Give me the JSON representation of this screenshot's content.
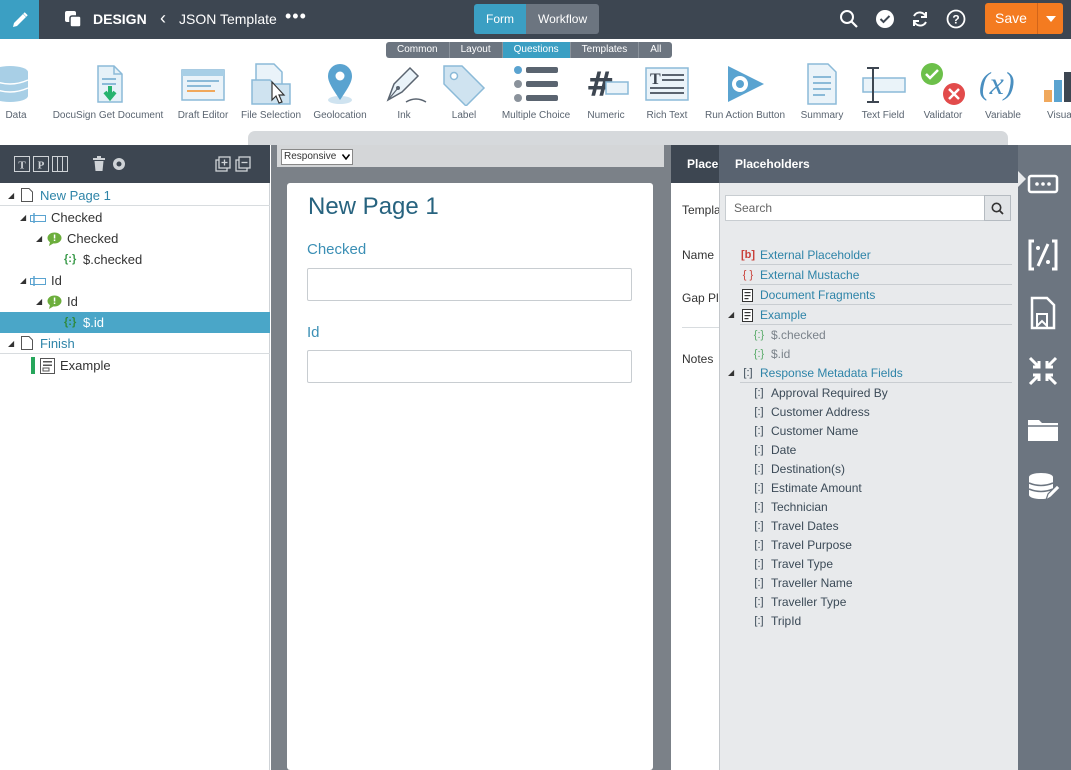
{
  "header": {
    "app_name": "DESIGN",
    "document_title": "JSON Template",
    "more": "•••",
    "mode_tabs": [
      {
        "label": "Form",
        "active": true
      },
      {
        "label": "Workflow",
        "active": false
      }
    ],
    "save_label": "Save",
    "accent_color": "#3b9fc3",
    "save_color": "#f47b20"
  },
  "toolbox": {
    "categories": [
      {
        "label": "Common",
        "active": false
      },
      {
        "label": "Layout",
        "active": false
      },
      {
        "label": "Questions",
        "active": true
      },
      {
        "label": "Templates",
        "active": false
      },
      {
        "label": "All",
        "active": false
      }
    ],
    "tools": [
      {
        "label": "Data",
        "icon": "database-icon"
      },
      {
        "label": "DocuSign Get Document",
        "icon": "docusign-document-icon"
      },
      {
        "label": "Draft Editor",
        "icon": "draft-editor-icon"
      },
      {
        "label": "File Selection",
        "icon": "file-selection-icon"
      },
      {
        "label": "Geolocation",
        "icon": "map-pin-icon"
      },
      {
        "label": "Ink",
        "icon": "pen-nib-icon"
      },
      {
        "label": "Label",
        "icon": "tag-icon"
      },
      {
        "label": "Multiple Choice",
        "icon": "list-icon"
      },
      {
        "label": "Numeric",
        "icon": "hash-icon"
      },
      {
        "label": "Rich Text",
        "icon": "rich-text-icon"
      },
      {
        "label": "Run Action Button",
        "icon": "gear-play-icon"
      },
      {
        "label": "Summary",
        "icon": "summary-document-icon"
      },
      {
        "label": "Text Field",
        "icon": "text-cursor-icon"
      },
      {
        "label": "Validator",
        "icon": "check-x-icon"
      },
      {
        "label": "Variable",
        "icon": "function-icon"
      },
      {
        "label": "Visua",
        "icon": "chart-icon"
      }
    ]
  },
  "tree": {
    "toolbar_icons": [
      "text-view-icon",
      "page-view-icon",
      "columns-view-icon",
      "delete-icon",
      "settings-icon",
      "copy-icon",
      "collapse-icon"
    ],
    "rows": [
      {
        "label": "New Page 1",
        "icon": "page-icon"
      },
      {
        "label": "Checked",
        "icon": "field-icon"
      },
      {
        "label": "Checked",
        "icon": "comment-icon"
      },
      {
        "label": "$.checked",
        "icon": "mustache-icon"
      },
      {
        "label": "Id",
        "icon": "field-icon"
      },
      {
        "label": "Id",
        "icon": "comment-icon"
      },
      {
        "label": "$.id",
        "icon": "mustache-icon",
        "selected": true
      },
      {
        "label": "Finish",
        "icon": "page-icon"
      },
      {
        "label": "Example",
        "icon": "document-fragment-icon"
      }
    ]
  },
  "canvas": {
    "layout_select": "Responsive",
    "page_title": "New Page 1",
    "questions": [
      {
        "label": "Checked",
        "value": ""
      },
      {
        "label": "Id",
        "value": ""
      }
    ]
  },
  "properties": {
    "header": "Placeh",
    "fields": [
      "Templa",
      "Name",
      "Gap Pla",
      "Notes"
    ]
  },
  "placeholders": {
    "title": "Placeholders",
    "search_placeholder": "Search",
    "items": [
      {
        "label": "External Placeholder",
        "icon": "[b]"
      },
      {
        "label": "External Mustache",
        "icon": "{ }"
      },
      {
        "label": "Document Fragments",
        "icon": "doc"
      },
      {
        "label": "Example",
        "icon": "doc"
      },
      {
        "label": "$.checked",
        "icon": "{:}"
      },
      {
        "label": "$.id",
        "icon": "{:}"
      },
      {
        "label": "Response Metadata Fields",
        "icon": "[:]"
      }
    ],
    "metadata_fields": [
      "Approval Required By",
      "Customer Address",
      "Customer Name",
      "Date",
      "Destination(s)",
      "Estimate Amount",
      "Technician",
      "Travel Dates",
      "Travel Purpose",
      "Travel Type",
      "Traveller Name",
      "Traveller Type",
      "TripId"
    ]
  },
  "right_rail": {
    "icons": [
      "placeholder-icon",
      "mustache-tool-icon",
      "bookmark-doc-icon",
      "collapse-arrows-icon",
      "folder-icon",
      "database-edit-icon"
    ]
  }
}
